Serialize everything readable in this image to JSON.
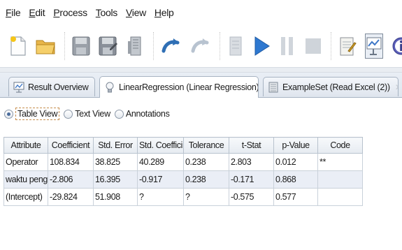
{
  "menu": {
    "items": [
      {
        "u": "F",
        "rest": "ile"
      },
      {
        "u": "E",
        "rest": "dit"
      },
      {
        "u": "P",
        "rest": "rocess"
      },
      {
        "u": "T",
        "rest": "ools"
      },
      {
        "u": "V",
        "rest": "iew"
      },
      {
        "u": "H",
        "rest": "elp"
      }
    ]
  },
  "toolbar": {
    "icons": [
      "new-document-icon",
      "open-folder-icon",
      "save-icon",
      "save-as-icon",
      "print-icon",
      "undo-icon",
      "redo-icon",
      "validate-icon",
      "run-play-icon",
      "pause-icon",
      "stop-icon",
      "notepad-icon",
      "result-perspective-icon",
      "info-icon"
    ]
  },
  "tabs": [
    {
      "label": "Result Overview",
      "close": "✕"
    },
    {
      "label": "LinearRegression (Linear Regression)",
      "close": "✕"
    },
    {
      "label": "ExampleSet (Read Excel (2))",
      "close": "✕"
    }
  ],
  "view_modes": {
    "options": [
      "Table View",
      "Text View",
      "Annotations"
    ],
    "selected": "Table View"
  },
  "table": {
    "headers": [
      "Attribute",
      "Coefficient",
      "Std. Error",
      "Std. Coeffici...",
      "Tolerance",
      "t-Stat",
      "p-Value",
      "Code"
    ],
    "rows": [
      [
        "Operator",
        "108.834",
        "38.825",
        "40.289",
        "0.238",
        "2.803",
        "0.012",
        "**"
      ],
      [
        "waktu penge",
        "-2.806",
        "16.395",
        "-0.917",
        "0.238",
        "-0.171",
        "0.868",
        ""
      ],
      [
        "(Intercept)",
        "-29.824",
        "51.908",
        "?",
        "?",
        "-0.575",
        "0.577",
        ""
      ]
    ]
  },
  "colors": {
    "accent_blue": "#3f78c8",
    "row_alt": "#eaeef6",
    "tab_border": "#a7b3c2",
    "selection_outline": "#c68e4e"
  }
}
